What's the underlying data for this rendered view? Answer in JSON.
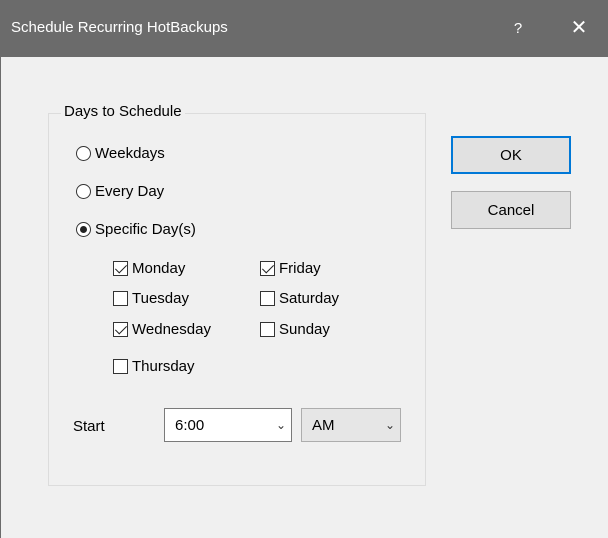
{
  "window": {
    "title": "Schedule Recurring HotBackups",
    "help_label": "?",
    "close_label": "✕"
  },
  "group": {
    "title": "Days to Schedule",
    "radios": [
      {
        "label": "Weekdays",
        "selected": false
      },
      {
        "label": "Every Day",
        "selected": false
      },
      {
        "label": "Specific Day(s)",
        "selected": true
      }
    ],
    "days": [
      {
        "label": "Monday",
        "checked": true
      },
      {
        "label": "Tuesday",
        "checked": false
      },
      {
        "label": "Wednesday",
        "checked": true
      },
      {
        "label": "Thursday",
        "checked": false
      },
      {
        "label": "Friday",
        "checked": true
      },
      {
        "label": "Saturday",
        "checked": false
      },
      {
        "label": "Sunday",
        "checked": false
      }
    ]
  },
  "start": {
    "label": "Start",
    "time_value": "6:00",
    "ampm_value": "AM"
  },
  "buttons": {
    "ok_label": "OK",
    "cancel_label": "Cancel"
  },
  "icons": {
    "dropdown": "chevron-down-icon",
    "close": "close-icon",
    "help": "help-icon"
  }
}
